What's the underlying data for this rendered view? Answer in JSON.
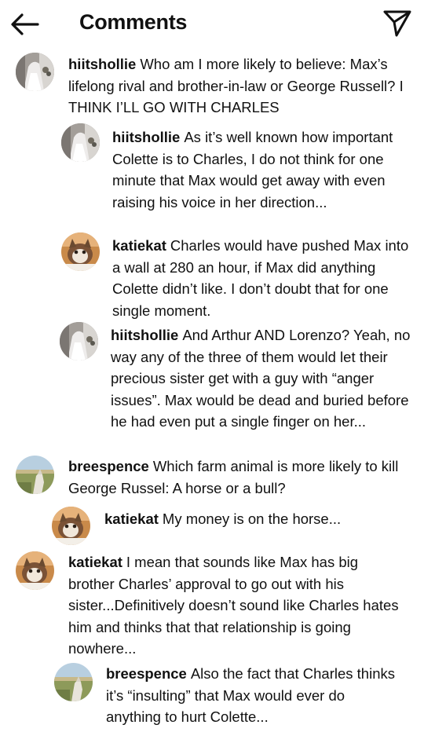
{
  "header": {
    "title": "Comments",
    "back_icon": "arrow-left-icon",
    "share_icon": "paper-plane-icon"
  },
  "comments": [
    {
      "username": "hiitshollie",
      "text": "Who am I more likely to believe: Max’s lifelong rival and brother-in-law or George Russell? I THINK I’LL GO WITH CHARLES",
      "avatar": "bride-photo"
    },
    {
      "username": "hiitshollie",
      "text": "As it’s well known how important Colette is to Charles, I do not think for one minute that Max would get away with even raising his voice in her direction...",
      "avatar": "bride-photo"
    },
    {
      "username": "katiekat",
      "text": "Charles would have pushed Max into a wall at 280 an hour, if Max did anything Colette didn’t like. I don’t doubt that for one single moment.",
      "avatar": "cat-photo"
    },
    {
      "username": "hiitshollie",
      "text": "And Arthur AND Lorenzo? Yeah, no way any of the three of them would let their precious sister get with a guy with “anger issues”. Max would be dead and buried before he had even put a single finger on her...",
      "avatar": "bride-photo"
    },
    {
      "username": "breespence",
      "text": "Which farm animal is more likely to kill George Russel: A horse or a bull?",
      "avatar": "horse-photo"
    },
    {
      "username": "katiekat",
      "text": "My money is on the horse...",
      "avatar": "cat-photo"
    },
    {
      "username": "katiekat",
      "text": "I mean that sounds like Max has big brother Charles’ approval to go out with his sister...Definitively doesn’t sound like Charles hates him and thinks that that relationship is going nowhere...",
      "avatar": "cat-photo"
    },
    {
      "username": "breespence",
      "text": "Also the fact that Charles thinks it’s “insulting” that Max would ever do anything to hurt Colette...",
      "avatar": "horse-photo"
    }
  ]
}
